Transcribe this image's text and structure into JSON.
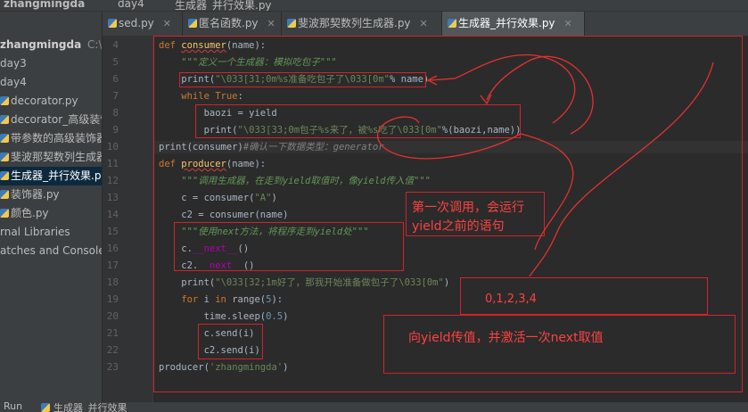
{
  "nav": {
    "project": "zhangmingda",
    "folder": "day4",
    "file": "生成器_并行效果.py"
  },
  "sidebar": {
    "project_root": "zhangmingda",
    "project_path": "C:\\Users",
    "items": [
      {
        "label": "day3",
        "icon": "folder-icon"
      },
      {
        "label": "day4",
        "icon": "folder-icon"
      },
      {
        "label": "decorator.py",
        "icon": "python-file-icon"
      },
      {
        "label": "decorator_高级装饰",
        "icon": "python-file-icon"
      },
      {
        "label": "带参数的高级装饰器",
        "icon": "python-file-icon"
      },
      {
        "label": "斐波那契数列生成器",
        "icon": "python-file-icon"
      },
      {
        "label": "生成器_并行效果.py",
        "icon": "python-file-icon"
      },
      {
        "label": "装饰器.py",
        "icon": "python-file-icon"
      },
      {
        "label": "颜色.py",
        "icon": "python-file-icon"
      }
    ],
    "external_libraries": "rnal Libraries",
    "scratches": "atches and Consoles"
  },
  "tabs": [
    {
      "label": "sed.py"
    },
    {
      "label": "匿名函数.py"
    },
    {
      "label": "斐波那契数列生成器.py"
    },
    {
      "label": "生成器_并行效果.py",
      "active": true
    }
  ],
  "line_numbers": [
    "4",
    "5",
    "6",
    "7",
    "8",
    "9",
    "10",
    "11",
    "12",
    "13",
    "14",
    "15",
    "16",
    "17",
    "18",
    "19",
    "20",
    "21",
    "22",
    "23"
  ],
  "code": {
    "l4_kw": "def ",
    "l4_name": "consumer",
    "l4_rest": "(name):",
    "l5": "    \"\"\"定义一个生成器：模拟吃包子\"\"\"",
    "l6_a": "    print(",
    "l6_str": "\"\\033[31;0m%s准备吃包子了\\033[0m\"",
    "l6_b": "% name)",
    "l7_kw": "    while ",
    "l7_true": "True",
    "l7_rest": ":",
    "l8": "        baozi = yield",
    "l9_a": "        print(",
    "l9_str": "\"\\033[33;0m包子%s来了，被%s吃了\\033[0m\"",
    "l9_b": "%(baozi,name))",
    "l10_a": "print(consumer)",
    "l10_b": "#确认一下数据类型：generator",
    "l11_kw": "def ",
    "l11_name": "producer",
    "l11_rest": "(name):",
    "l12": "    \"\"\"调用生成器，在走到yield取值时，像yield传入值\"\"\"",
    "l13_a": "    c = consumer(",
    "l13_str": "\"A\"",
    "l13_b": ")",
    "l14": "    c2 = consumer(name)",
    "l15": "    \"\"\"使用next方法，将程序走到yield处\"\"\"",
    "l16_a": "    c.",
    "l16_attr": "__next__",
    "l16_b": "()",
    "l17_a": "    c2.",
    "l17_attr": "__next__",
    "l17_b": "()",
    "l18_a": "    print(",
    "l18_str": "\"\\033[32;1m好了，那我开始准备做包子了\\033[0m\"",
    "l18_b": ")",
    "l19_kw": "    for ",
    "l19_i": "i ",
    "l19_in": "in ",
    "l19_range": "range(",
    "l19_num": "5",
    "l19_end": "):",
    "l20_a": "        time.sleep(",
    "l20_num": "0.5",
    "l20_b": ")",
    "l21": "        c.send(i)",
    "l22": "        c2.send(i)",
    "l23_a": "producer(",
    "l23_str": "'zhangmingda'",
    "l23_b": ")"
  },
  "annotations": {
    "first_call": "第一次调用，会运行",
    "first_call_2": "yield之前的语句",
    "range_values": "0,1,2,3,4",
    "send_note": "向yield传值，并激活一次next取值"
  },
  "status": {
    "run_label": "Run",
    "run_file": "生成器_并行效果"
  },
  "colors": {
    "annotation_red": "#d4222a",
    "accent": "#ff4040"
  }
}
